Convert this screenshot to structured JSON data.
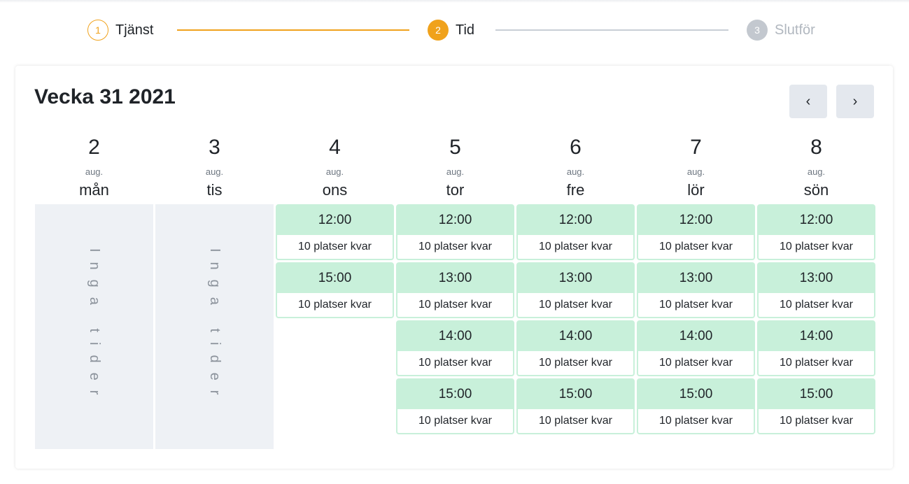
{
  "stepper": {
    "steps": [
      {
        "number": "1",
        "label": "Tjänst",
        "state": "done"
      },
      {
        "number": "2",
        "label": "Tid",
        "state": "active"
      },
      {
        "number": "3",
        "label": "Slutför",
        "state": "pending"
      }
    ]
  },
  "calendar": {
    "title": "Vecka 31 2021",
    "prev_label": "‹",
    "next_label": "›",
    "days": [
      {
        "num": "2",
        "month": "aug.",
        "name": "mån",
        "empty_text": "Inga tider",
        "slots": []
      },
      {
        "num": "3",
        "month": "aug.",
        "name": "tis",
        "empty_text": "Inga tider",
        "slots": []
      },
      {
        "num": "4",
        "month": "aug.",
        "name": "ons",
        "slots": [
          {
            "time": "12:00",
            "availability": "10 platser kvar"
          },
          {
            "time": "15:00",
            "availability": "10 platser kvar"
          }
        ]
      },
      {
        "num": "5",
        "month": "aug.",
        "name": "tor",
        "slots": [
          {
            "time": "12:00",
            "availability": "10 platser kvar"
          },
          {
            "time": "13:00",
            "availability": "10 platser kvar"
          },
          {
            "time": "14:00",
            "availability": "10 platser kvar"
          },
          {
            "time": "15:00",
            "availability": "10 platser kvar"
          }
        ]
      },
      {
        "num": "6",
        "month": "aug.",
        "name": "fre",
        "slots": [
          {
            "time": "12:00",
            "availability": "10 platser kvar"
          },
          {
            "time": "13:00",
            "availability": "10 platser kvar"
          },
          {
            "time": "14:00",
            "availability": "10 platser kvar"
          },
          {
            "time": "15:00",
            "availability": "10 platser kvar"
          }
        ]
      },
      {
        "num": "7",
        "month": "aug.",
        "name": "lör",
        "slots": [
          {
            "time": "12:00",
            "availability": "10 platser kvar"
          },
          {
            "time": "13:00",
            "availability": "10 platser kvar"
          },
          {
            "time": "14:00",
            "availability": "10 platser kvar"
          },
          {
            "time": "15:00",
            "availability": "10 platser kvar"
          }
        ]
      },
      {
        "num": "8",
        "month": "aug.",
        "name": "sön",
        "slots": [
          {
            "time": "12:00",
            "availability": "10 platser kvar"
          },
          {
            "time": "13:00",
            "availability": "10 platser kvar"
          },
          {
            "time": "14:00",
            "availability": "10 platser kvar"
          },
          {
            "time": "15:00",
            "availability": "10 platser kvar"
          }
        ]
      }
    ]
  },
  "colors": {
    "accent": "#f0a21c",
    "slot_bg": "#c8f0da",
    "inactive_step": "#c3c8cf",
    "empty_day_bg": "#eef1f5"
  }
}
